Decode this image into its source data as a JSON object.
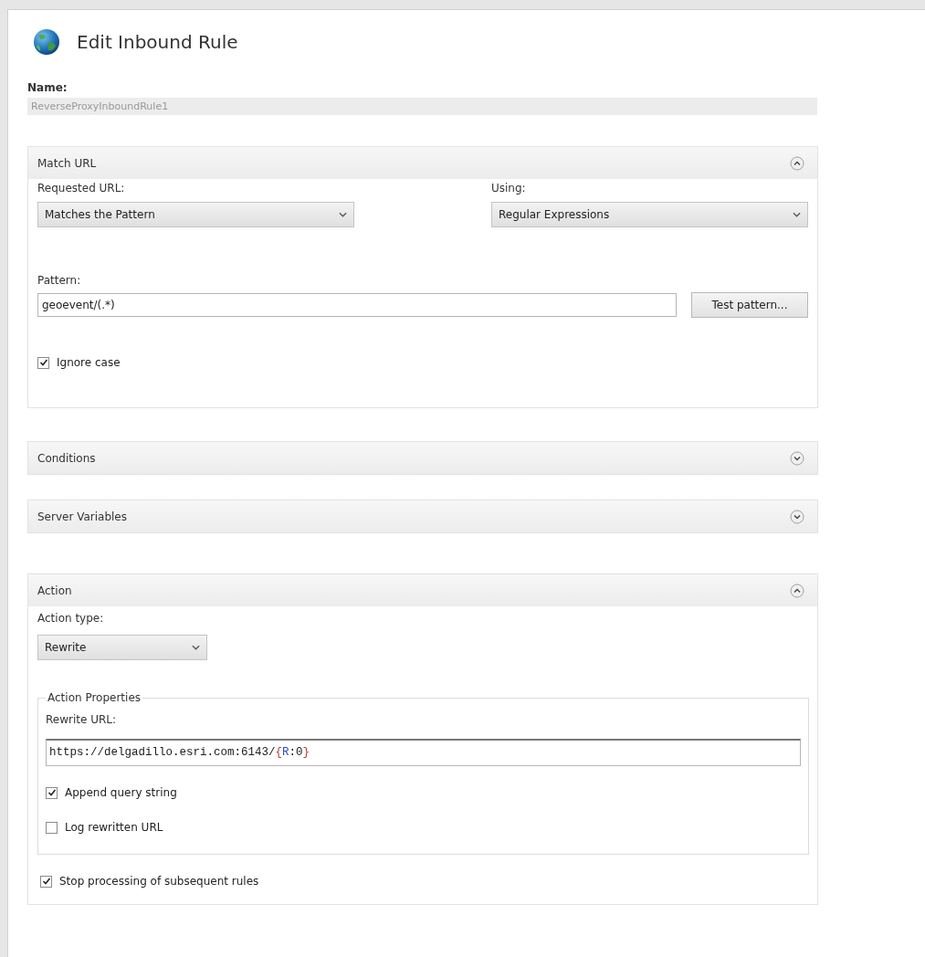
{
  "title": "Edit Inbound Rule",
  "name_field": {
    "label": "Name:",
    "value": "ReverseProxyInboundRule1",
    "disabled": true
  },
  "sections": [
    {
      "kind": "match",
      "title": "Match URL",
      "expanded": true,
      "requested_url": {
        "label": "Requested URL:",
        "value": "Matches the Pattern"
      },
      "using": {
        "label": "Using:",
        "value": "Regular Expressions"
      },
      "pattern": {
        "label": "Pattern:",
        "value": "geoevent/(.*)",
        "button": "Test pattern..."
      },
      "checkboxes": [
        {
          "label": "Ignore case",
          "checked": true
        }
      ]
    },
    {
      "title": "Conditions",
      "expanded": false
    },
    {
      "title": "Server Variables",
      "expanded": false
    },
    {
      "kind": "action",
      "title": "Action",
      "expanded": true,
      "action_type": {
        "label": "Action type:",
        "value": "Rewrite"
      },
      "properties": {
        "legend": "Action Properties",
        "rewrite_label": "Rewrite URL:",
        "rewrite_segments": [
          {
            "text": "https://delgadillo.esri.com:6143/",
            "color": "#202020"
          },
          {
            "text": "{",
            "color": "#c0392b"
          },
          {
            "text": "R",
            "color": "#2a4fd0"
          },
          {
            "text": ":0",
            "color": "#202020"
          },
          {
            "text": "}",
            "color": "#c0392b"
          }
        ],
        "checkboxes": [
          {
            "label": "Append query string",
            "checked": true
          },
          {
            "label": "Log rewritten URL",
            "checked": false
          }
        ]
      },
      "checkboxes": [
        {
          "label": "Stop processing of subsequent rules",
          "checked": true
        }
      ]
    }
  ]
}
